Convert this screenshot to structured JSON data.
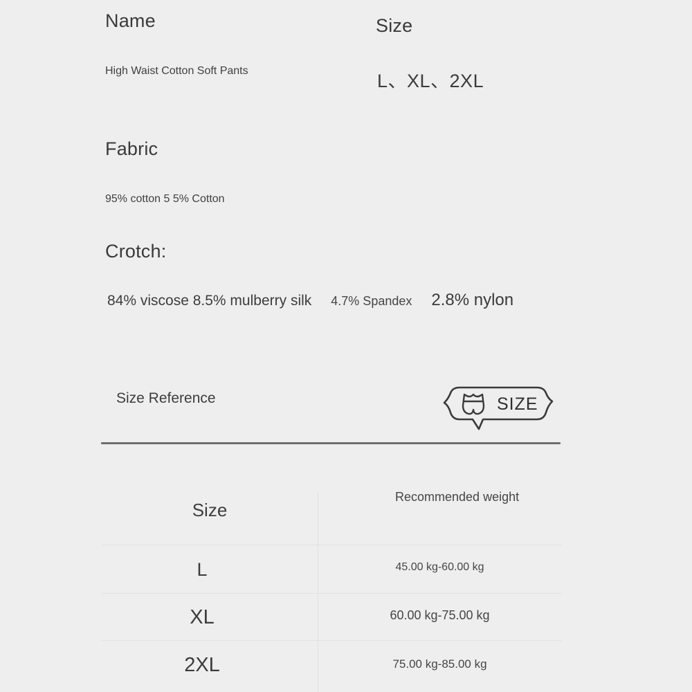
{
  "product": {
    "name_heading": "Name",
    "name_value": "High Waist Cotton Soft Pants",
    "size_heading": "Size",
    "size_value": "L、XL、2XL",
    "fabric_heading": "Fabric",
    "fabric_value": "95% cotton 5 5% Cotton",
    "crotch_heading": "Crotch:",
    "crotch_parts": [
      "84% viscose 8.5% mulberry silk",
      "4.7% Spandex",
      "2.8% nylon"
    ]
  },
  "size_reference": {
    "label": "Size Reference",
    "badge_text": "SIZE",
    "badge_icon": "underwear-icon"
  },
  "size_table": {
    "columns": [
      "Size",
      "Recommended weight"
    ],
    "rows": [
      {
        "size": "L",
        "weight": "45.00 kg-60.00 kg"
      },
      {
        "size": "XL",
        "weight": "60.00 kg-75.00 kg"
      },
      {
        "size": "2XL",
        "weight": "75.00 kg-85.00 kg"
      }
    ]
  },
  "colors": {
    "background": "#eeeeee",
    "text": "#3c3c3c",
    "rule": "#6e6e6e",
    "table_line": "#e2e2e2"
  }
}
